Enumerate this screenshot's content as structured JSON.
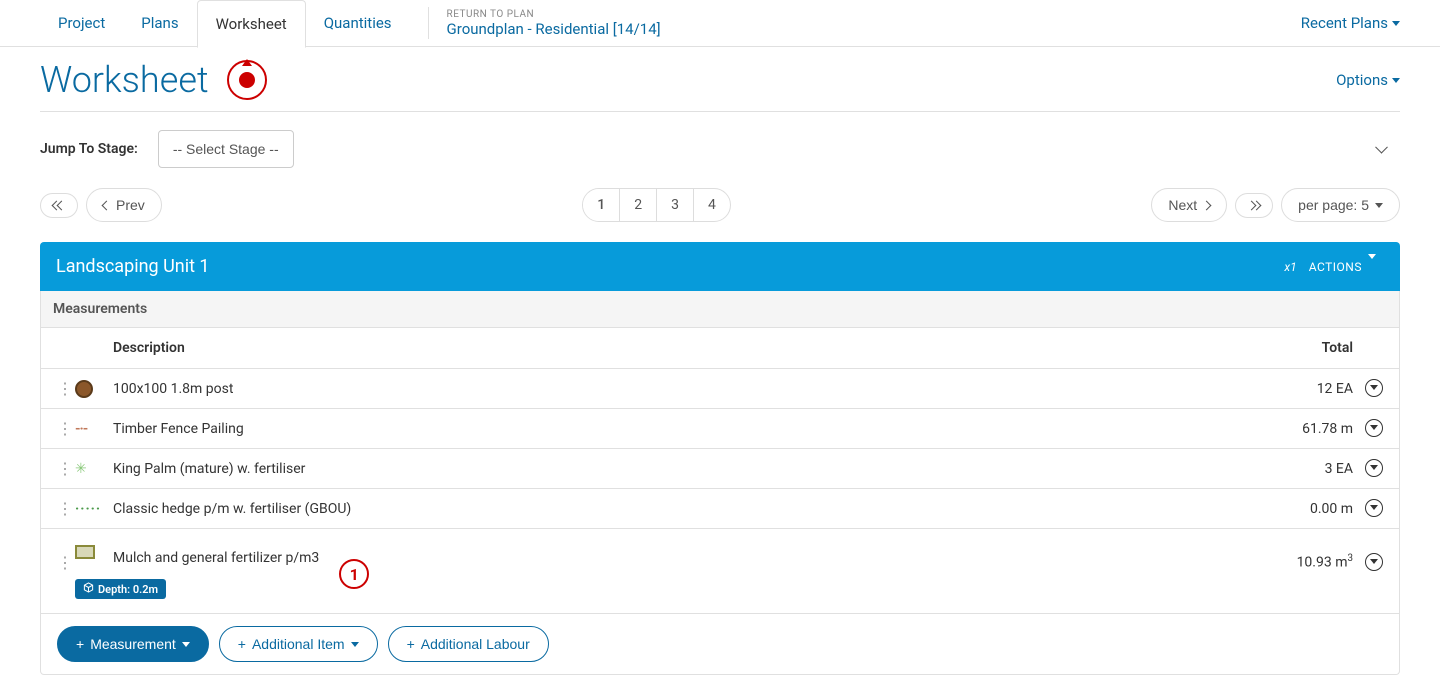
{
  "tabs": {
    "project": "Project",
    "plans": "Plans",
    "worksheet": "Worksheet",
    "quantities": "Quantities"
  },
  "return": {
    "label": "RETURN TO PLAN",
    "link": "Groundplan - Residential [14/14]"
  },
  "recent_plans": "Recent Plans",
  "page_title": "Worksheet",
  "options": "Options",
  "jump_label": "Jump To Stage:",
  "stage_placeholder": "-- Select Stage --",
  "pager": {
    "prev": "Prev",
    "next": "Next",
    "pages": [
      "1",
      "2",
      "3",
      "4"
    ],
    "per_page": "per page: 5"
  },
  "unit": {
    "title": "Landscaping Unit 1",
    "mult": "x1",
    "actions": "ACTIONS"
  },
  "section_label": "Measurements",
  "columns": {
    "desc": "Description",
    "total": "Total"
  },
  "rows": [
    {
      "icon": "circle-brown",
      "desc": "100x100 1.8m post",
      "total": "12 EA"
    },
    {
      "icon": "dashline",
      "desc": "Timber Fence Pailing",
      "total": "61.78 m"
    },
    {
      "icon": "star-green",
      "desc": "King Palm (mature) w. fertiliser",
      "total": "3 EA"
    },
    {
      "icon": "dots-green",
      "desc": "Classic hedge p/m w. fertiliser (GBOU)",
      "total": "0.00 m"
    },
    {
      "icon": "rect-olive",
      "desc": "Mulch and general fertilizer p/m3",
      "total_html": "10.93 m³",
      "depth": "Depth: 0.2m",
      "marker": "1"
    }
  ],
  "buttons": {
    "measurement": "Measurement",
    "add_item": "Additional Item",
    "add_labour": "Additional Labour"
  }
}
